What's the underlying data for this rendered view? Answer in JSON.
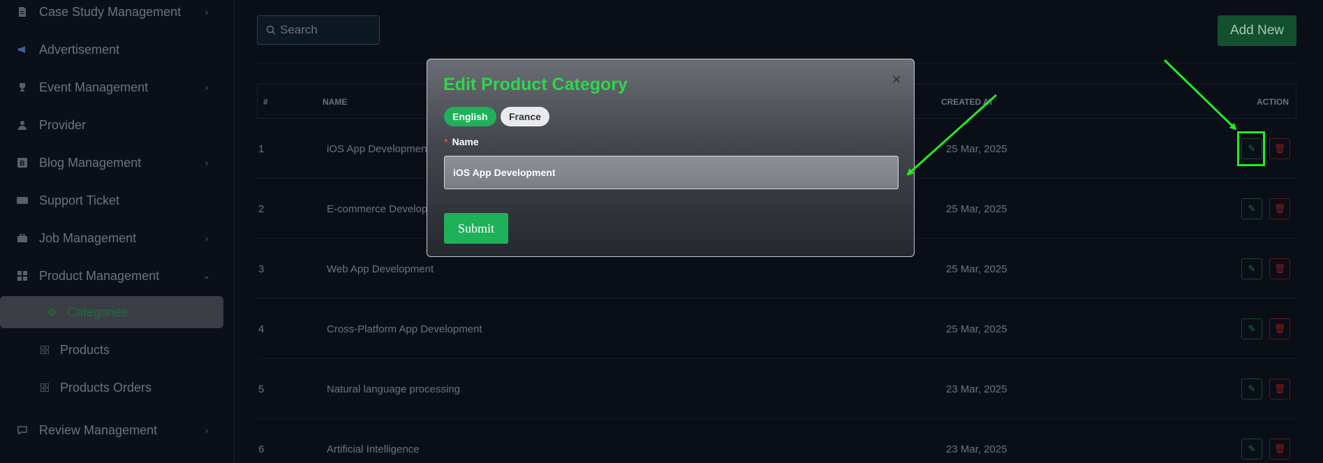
{
  "sidebar": {
    "items": [
      {
        "label": "Case Study Management",
        "icon": "file-icon",
        "chevron": "›"
      },
      {
        "label": "Advertisement",
        "icon": "megaphone-icon",
        "chevron": ""
      },
      {
        "label": "Event Management",
        "icon": "trophy-icon",
        "chevron": "›"
      },
      {
        "label": "Provider",
        "icon": "user-icon",
        "chevron": ""
      },
      {
        "label": "Blog Management",
        "icon": "blog-icon",
        "chevron": "›"
      },
      {
        "label": "Support Ticket",
        "icon": "ticket-icon",
        "chevron": ""
      },
      {
        "label": "Job Management",
        "icon": "briefcase-icon",
        "chevron": "›"
      },
      {
        "label": "Product Management",
        "icon": "grid-icon",
        "chevron": "⌄"
      },
      {
        "label": "Categories",
        "icon": "gear-icon",
        "chevron": ""
      },
      {
        "label": "Products",
        "icon": "grid-icon",
        "chevron": ""
      },
      {
        "label": "Products Orders",
        "icon": "grid-icon",
        "chevron": ""
      },
      {
        "label": "Review Management",
        "icon": "chat-icon",
        "chevron": "›"
      }
    ]
  },
  "search": {
    "placeholder": "Search"
  },
  "add_button": {
    "label": "Add New"
  },
  "table": {
    "headers": {
      "num": "#",
      "name": "NAME",
      "created": "CREATED AT",
      "action": "ACTION"
    },
    "rows": [
      {
        "num": "1",
        "name": "iOS App Development",
        "created": "25 Mar, 2025"
      },
      {
        "num": "2",
        "name": "E-commerce Development",
        "created": "25 Mar, 2025"
      },
      {
        "num": "3",
        "name": "Web App Development",
        "created": "25 Mar, 2025"
      },
      {
        "num": "4",
        "name": "Cross-Platform App Development",
        "created": "25 Mar, 2025"
      },
      {
        "num": "5",
        "name": "Natural language processing",
        "created": "23 Mar, 2025"
      },
      {
        "num": "6",
        "name": "Artificial Intelligence",
        "created": "23 Mar, 2025"
      }
    ]
  },
  "modal": {
    "title": "Edit Product Category",
    "close": "×",
    "languages": [
      "English",
      "France"
    ],
    "field_label": "Name",
    "required_mark": "*",
    "name_value": "iOS App Development",
    "submit": "Submit"
  },
  "colors": {
    "accent": "#1fb05a",
    "title": "#2bd84a",
    "annotation": "#1ef01e",
    "danger": "#8a1f1f"
  }
}
